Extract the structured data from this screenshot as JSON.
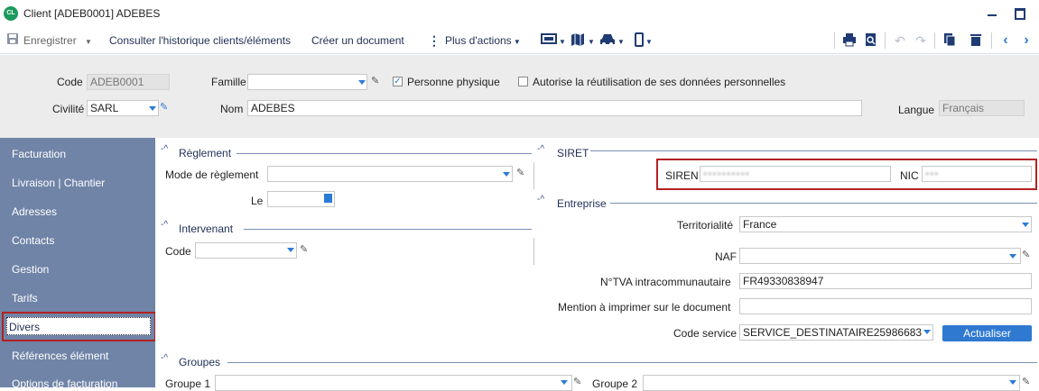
{
  "window": {
    "logo_text": "CL",
    "title": "Client [ADEB0001] ADEBES"
  },
  "toolbar": {
    "save_label": "Enregistrer",
    "history_label": "Consulter l'historique clients/éléments",
    "create_doc_label": "Créer un document",
    "more_actions_label": "Plus d'actions"
  },
  "header": {
    "code_label": "Code",
    "code_value": "ADEB0001",
    "famille_label": "Famille",
    "famille_value": "",
    "personne_physique_label": "Personne physique",
    "personne_physique_checked": true,
    "reuse_label": "Autorise la réutilisation de ses données personnelles",
    "reuse_checked": false,
    "civilite_label": "Civilité",
    "civilite_value": "SARL",
    "nom_label": "Nom",
    "nom_value": "ADEBES",
    "langue_label": "Langue",
    "langue_value": "Français"
  },
  "sidebar": {
    "items": [
      {
        "label": "Facturation"
      },
      {
        "label": "Livraison | Chantier"
      },
      {
        "label": "Adresses"
      },
      {
        "label": "Contacts"
      },
      {
        "label": "Gestion"
      },
      {
        "label": "Tarifs"
      },
      {
        "label": "Divers"
      },
      {
        "label": "Références élément"
      },
      {
        "label": "Options de facturation"
      }
    ],
    "selected": "Divers"
  },
  "reglement": {
    "title": "Règlement",
    "mode_label": "Mode de règlement",
    "mode_value": "",
    "le_label": "Le",
    "le_value": ""
  },
  "intervenant": {
    "title": "Intervenant",
    "code_label": "Code",
    "code_value": ""
  },
  "siret": {
    "title": "SIRET",
    "siren_label": "SIREN",
    "siren_value": "••••••••••",
    "nic_label": "NIC",
    "nic_value": "•••"
  },
  "entreprise": {
    "title": "Entreprise",
    "territorialite_label": "Territorialité",
    "territorialite_value": "France",
    "naf_label": "NAF",
    "naf_value": "",
    "tva_label": "N°TVA intracommunautaire",
    "tva_value": "FR49330838947",
    "mention_label": "Mention à imprimer sur le document",
    "mention_value": "",
    "code_service_label": "Code service",
    "code_service_value": "SERVICE_DESTINATAIRE25986683",
    "actualiser_label": "Actualiser"
  },
  "groupes": {
    "title": "Groupes",
    "groupe1_label": "Groupe 1",
    "groupe1_value": "",
    "groupe2_label": "Groupe 2",
    "groupe2_value": ""
  },
  "colors": {
    "accent": "#2f79d1",
    "sidebar": "#6f84a7",
    "highlight": "#b22222",
    "brand": "#1a9a5c"
  }
}
